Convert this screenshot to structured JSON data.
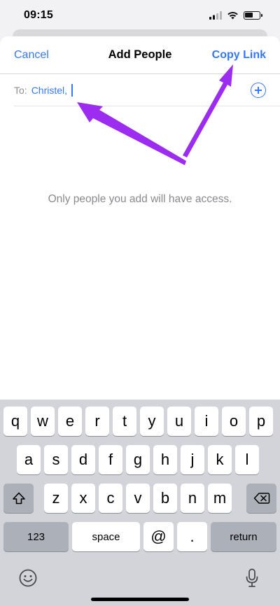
{
  "status_bar": {
    "time": "09:15"
  },
  "nav": {
    "cancel": "Cancel",
    "title": "Add People",
    "copy_link": "Copy Link"
  },
  "recipients": {
    "label": "To:",
    "chip": "Christel,"
  },
  "empty_state": "Only people you add will have access.",
  "keyboard": {
    "row1": [
      "q",
      "w",
      "e",
      "r",
      "t",
      "y",
      "u",
      "i",
      "o",
      "p"
    ],
    "row2": [
      "a",
      "s",
      "d",
      "f",
      "g",
      "h",
      "j",
      "k",
      "l"
    ],
    "row3": [
      "z",
      "x",
      "c",
      "v",
      "b",
      "n",
      "m"
    ],
    "numbers": "123",
    "space": "space",
    "at": "@",
    "dot": ".",
    "return": "return"
  },
  "colors": {
    "accent": "#3478f6",
    "arrow": "#9b2cf0",
    "keyboard_bg": "#d2d4d9"
  },
  "icons": [
    "signal-icon",
    "wifi-icon",
    "battery-icon",
    "add-contact-icon",
    "shift-icon",
    "backspace-icon",
    "emoji-icon",
    "microphone-icon"
  ]
}
